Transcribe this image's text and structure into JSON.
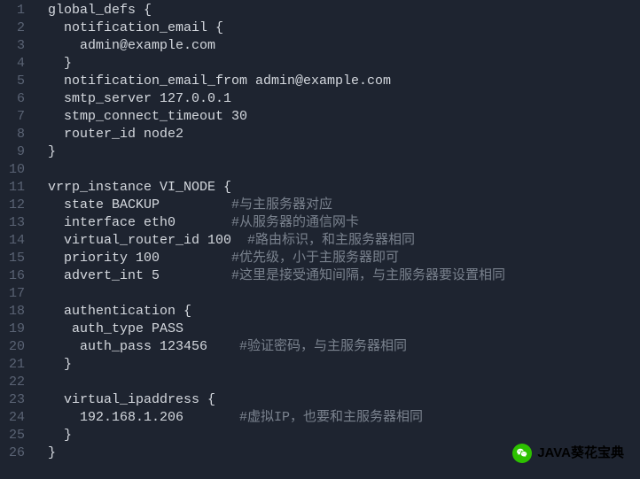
{
  "lines": [
    {
      "n": "1",
      "code": "global_defs {"
    },
    {
      "n": "2",
      "code": "  notification_email {"
    },
    {
      "n": "3",
      "code": "    admin@example.com"
    },
    {
      "n": "4",
      "code": "  }"
    },
    {
      "n": "5",
      "code": "  notification_email_from admin@example.com"
    },
    {
      "n": "6",
      "code": "  smtp_server 127.0.0.1"
    },
    {
      "n": "7",
      "code": "  stmp_connect_timeout 30"
    },
    {
      "n": "8",
      "code": "  router_id node2"
    },
    {
      "n": "9",
      "code": "}"
    },
    {
      "n": "10",
      "code": ""
    },
    {
      "n": "11",
      "code": "vrrp_instance VI_NODE {"
    },
    {
      "n": "12",
      "code": "  state BACKUP         ",
      "comment": "#与主服务器对应"
    },
    {
      "n": "13",
      "code": "  interface eth0       ",
      "comment": "#从服务器的通信网卡"
    },
    {
      "n": "14",
      "code": "  virtual_router_id 100  ",
      "comment": "#路由标识，和主服务器相同"
    },
    {
      "n": "15",
      "code": "  priority 100         ",
      "comment": "#优先级，小于主服务器即可"
    },
    {
      "n": "16",
      "code": "  advert_int 5         ",
      "comment": "#这里是接受通知间隔，与主服务器要设置相同"
    },
    {
      "n": "17",
      "code": ""
    },
    {
      "n": "18",
      "code": "  authentication {"
    },
    {
      "n": "19",
      "code": "   auth_type PASS"
    },
    {
      "n": "20",
      "code": "    auth_pass 123456    ",
      "comment": "#验证密码，与主服务器相同"
    },
    {
      "n": "21",
      "code": "  }"
    },
    {
      "n": "22",
      "code": ""
    },
    {
      "n": "23",
      "code": "  virtual_ipaddress {"
    },
    {
      "n": "24",
      "code": "    192.168.1.206       ",
      "comment": "#虚拟IP，也要和主服务器相同"
    },
    {
      "n": "25",
      "code": "  }"
    },
    {
      "n": "26",
      "code": "}"
    }
  ],
  "watermark": {
    "text": "JAVA葵花宝典"
  }
}
